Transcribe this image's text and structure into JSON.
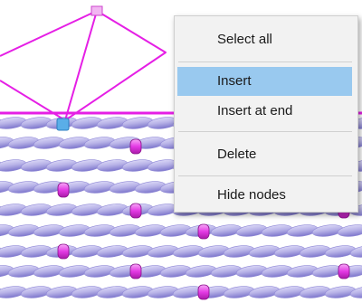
{
  "colors": {
    "background": "#ffffff",
    "curve_line": "#e51fe5",
    "strand_fill": "#b9b4e8",
    "strand_edge": "#6f68c4",
    "node_fill": "#e43ae4",
    "selected_node": "#5aaee8",
    "menu_background": "#f2f2f2",
    "menu_highlight": "#99c9ef",
    "menu_text": "#1a1a1a"
  },
  "context_menu": {
    "items": [
      {
        "label": "Select all",
        "highlighted": false
      },
      {
        "label": "Insert",
        "highlighted": true
      },
      {
        "label": "Insert at end",
        "highlighted": false
      },
      {
        "label": "Delete",
        "highlighted": false
      },
      {
        "label": "Hide nodes",
        "highlighted": false
      }
    ]
  }
}
